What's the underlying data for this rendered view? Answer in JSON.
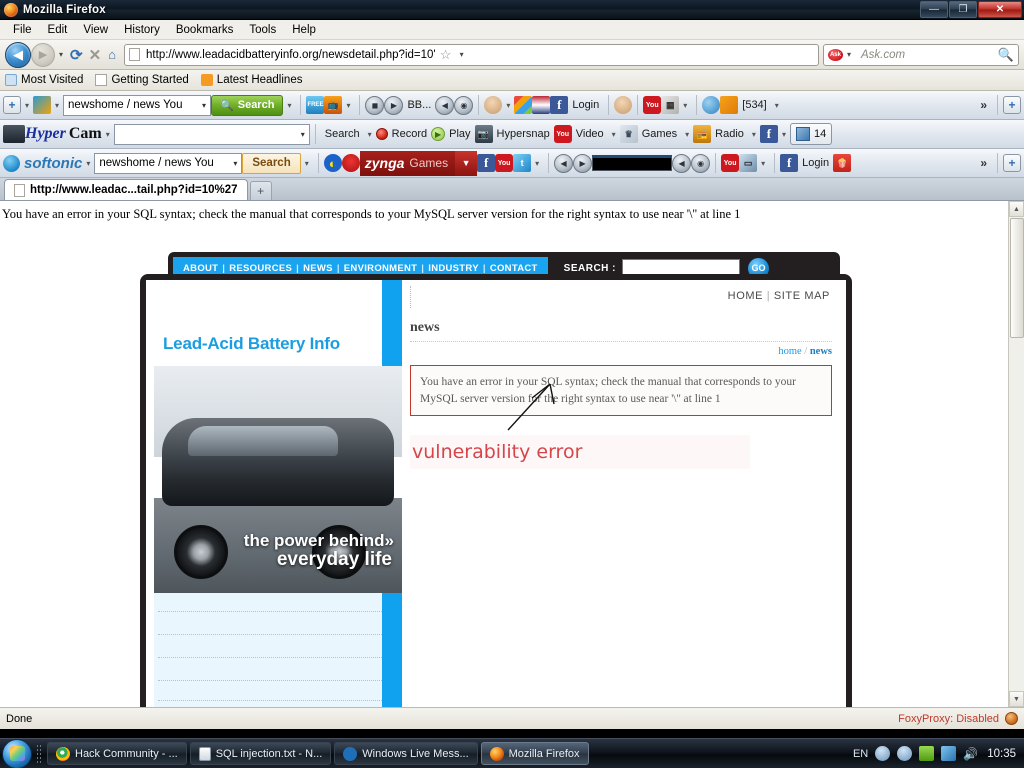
{
  "window": {
    "title": "Mozilla Firefox",
    "controls": {
      "minimize": "—",
      "maximize": "❐",
      "close": "✕"
    }
  },
  "menubar": [
    {
      "label": "File"
    },
    {
      "label": "Edit"
    },
    {
      "label": "View"
    },
    {
      "label": "History"
    },
    {
      "label": "Bookmarks"
    },
    {
      "label": "Tools"
    },
    {
      "label": "Help"
    }
  ],
  "navbar": {
    "back": "◀",
    "forward": "▶",
    "dropdown": "▾",
    "reload": "⟳",
    "stop": "✕",
    "home": "⌂",
    "url": "http://www.leadacidbatteryinfo.org/newsdetail.php?id=10'",
    "star": "☆",
    "star_caret": "▾",
    "search_engine": "Ask",
    "search_caret": "▾",
    "search_placeholder": "Ask.com",
    "search_icon": "search-icon"
  },
  "bookmarks": [
    {
      "label": "Most Visited",
      "icon": "globe-icon"
    },
    {
      "label": "Getting Started",
      "icon": "page-icon"
    },
    {
      "label": "Latest Headlines",
      "icon": "rss-icon"
    }
  ],
  "toolbar1": {
    "combo_value": "newshome / news You",
    "search_label": "Search",
    "bb_label": "BB...",
    "login_label": "Login",
    "count_label": "[534]",
    "overflow": "»",
    "plus": "+"
  },
  "toolbar2": {
    "brand1": "Hyper",
    "brand2": "Cam",
    "combo_value": "",
    "search_label": "Search",
    "record_label": "Record",
    "play_label": "Play",
    "hypersnap_label": "Hypersnap",
    "video_label": "Video",
    "games_label": "Games",
    "radio_label": "Radio",
    "count": "14",
    "caret": "▾"
  },
  "toolbar3": {
    "brand": "softonic",
    "combo_value": "newshome / news You",
    "search_label": "Search",
    "zynga_brand": "zynga",
    "zynga_games": "Games",
    "login_label": "Login",
    "overflow": "»",
    "plus": "+"
  },
  "tab": {
    "title": "http://www.leadac...tail.php?id=10%27",
    "newtab": "+"
  },
  "page_error_top": "You have an error in your SQL syntax; check the manual that corresponds to your MySQL server version for the right syntax to use near '\\'' at line 1",
  "site": {
    "nav": [
      "ABOUT",
      "RESOURCES",
      "NEWS",
      "ENVIRONMENT",
      "INDUSTRY",
      "CONTACT"
    ],
    "nav_separator": "|",
    "search_label": "SEARCH :",
    "search_value": "",
    "go_label": "GO",
    "header_links": [
      "HOME",
      "SITE MAP"
    ],
    "header_links_sep": "|",
    "logo": "Lead-Acid Battery Info",
    "tagline_line1": "the power behind",
    "tagline_arrow": "»",
    "tagline_line2": "everyday life",
    "page_title": "news",
    "breadcrumb_home": "home",
    "breadcrumb_sep": "/",
    "breadcrumb_current": "news",
    "error_text": "You have an error in your SQL syntax; check the manual that corresponds to your MySQL server version for the right syntax to use near '\\'' at line 1",
    "annotation": "vulnerability error"
  },
  "statusbar": {
    "status": "Done",
    "foxyproxy": "FoxyProxy: Disabled"
  },
  "taskbar": {
    "start": "start-orb",
    "items": [
      {
        "label": "Hack Community - ...",
        "icon": "chrome-icon",
        "active": false
      },
      {
        "label": "SQL injection.txt - N...",
        "icon": "notepad-icon",
        "active": false
      },
      {
        "label": "Windows Live Mess...",
        "icon": "messenger-icon",
        "active": false
      },
      {
        "label": "Mozilla Firefox",
        "icon": "firefox-icon",
        "active": true
      }
    ],
    "language": "EN",
    "clock": "10:35"
  },
  "colors": {
    "accent_blue": "#11a2ef",
    "error_red": "#c0392b",
    "annotation_red": "#d6454a",
    "dark_panel": "#231f20"
  }
}
